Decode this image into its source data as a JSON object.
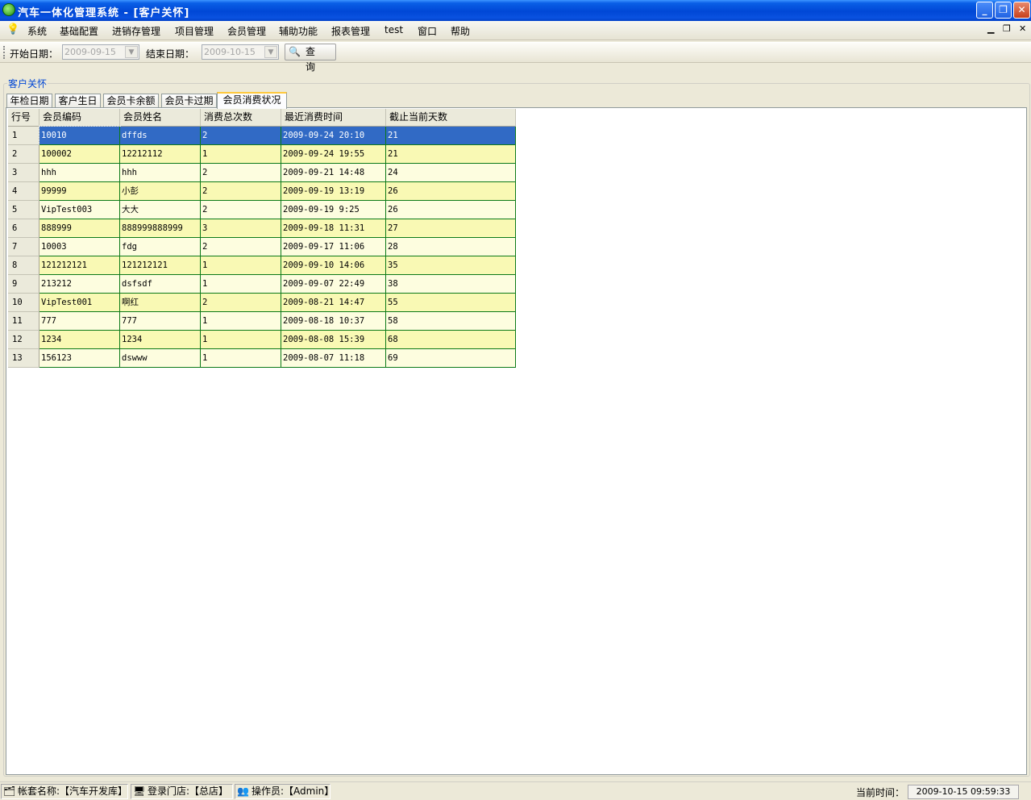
{
  "window": {
    "title": "汽车一体化管理系统 - [客户关怀]"
  },
  "menu": [
    "系统",
    "基础配置",
    "进销存管理",
    "项目管理",
    "会员管理",
    "辅助功能",
    "报表管理",
    "test",
    "窗口",
    "帮助"
  ],
  "toolbar": {
    "start_label": "开始日期：",
    "start_value": "2009-09-15",
    "end_label": "结束日期：",
    "end_value": "2009-10-15",
    "query_label": "查 询"
  },
  "group_title": "客户关怀",
  "tabs": [
    "年检日期",
    "客户生日",
    "会员卡余额",
    "会员卡过期",
    "会员消费状况"
  ],
  "active_tab": 4,
  "grid": {
    "columns": [
      "行号",
      "会员编码",
      "会员姓名",
      "消费总次数",
      "最近消费时间",
      "截止当前天数"
    ],
    "rows": [
      [
        "1",
        "10010",
        "dffds",
        "2",
        "2009-09-24 20:10",
        "21"
      ],
      [
        "2",
        "100002",
        "12212112",
        "1",
        "2009-09-24 19:55",
        "21"
      ],
      [
        "3",
        "hhh",
        "hhh",
        "2",
        "2009-09-21 14:48",
        "24"
      ],
      [
        "4",
        "99999",
        "小彭",
        "2",
        "2009-09-19 13:19",
        "26"
      ],
      [
        "5",
        "VipTest003",
        "大大",
        "2",
        "2009-09-19 9:25",
        "26"
      ],
      [
        "6",
        "888999",
        "888999888999",
        "3",
        "2009-09-18 11:31",
        "27"
      ],
      [
        "7",
        "10003",
        "fdg",
        "2",
        "2009-09-17 11:06",
        "28"
      ],
      [
        "8",
        "121212121",
        "121212121",
        "1",
        "2009-09-10 14:06",
        "35"
      ],
      [
        "9",
        "213212",
        "dsfsdf",
        "1",
        "2009-09-07 22:49",
        "38"
      ],
      [
        "10",
        "VipTest001",
        "啊红",
        "2",
        "2009-08-21 14:47",
        "55"
      ],
      [
        "11",
        "777",
        "777",
        "1",
        "2009-08-18 10:37",
        "58"
      ],
      [
        "12",
        "1234",
        "1234",
        "1",
        "2009-08-08 15:39",
        "68"
      ],
      [
        "13",
        "156123",
        "dswww",
        "1",
        "2009-08-07 11:18",
        "69"
      ]
    ],
    "selected_row": 0
  },
  "status": {
    "account": "帐套名称:【汽车开发库】",
    "store": "登录门店:【总店】",
    "operator": "操作员:【Admin】",
    "time_label": "当前时间：",
    "time_value": "2009-10-15 09:59:33"
  }
}
